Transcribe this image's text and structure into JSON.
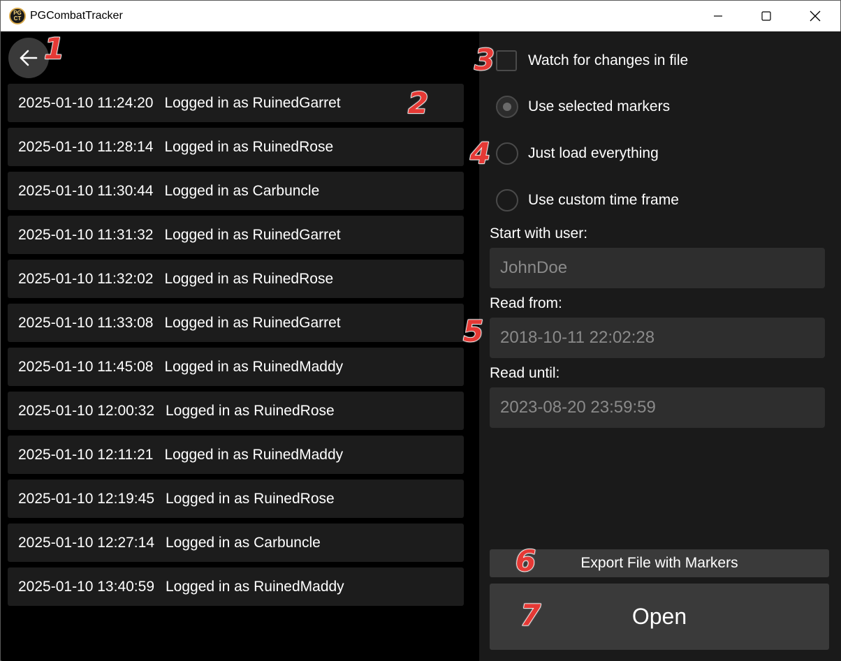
{
  "window": {
    "title": "PGCombatTracker",
    "icon_text": "PG\nCT"
  },
  "logins": [
    {
      "timestamp": "2025-01-10 11:24:20",
      "text": "Logged in as RuinedGarret"
    },
    {
      "timestamp": "2025-01-10 11:28:14",
      "text": "Logged in as RuinedRose"
    },
    {
      "timestamp": "2025-01-10 11:30:44",
      "text": "Logged in as Carbuncle"
    },
    {
      "timestamp": "2025-01-10 11:31:32",
      "text": "Logged in as RuinedGarret"
    },
    {
      "timestamp": "2025-01-10 11:32:02",
      "text": "Logged in as RuinedRose"
    },
    {
      "timestamp": "2025-01-10 11:33:08",
      "text": "Logged in as RuinedGarret"
    },
    {
      "timestamp": "2025-01-10 11:45:08",
      "text": "Logged in as RuinedMaddy"
    },
    {
      "timestamp": "2025-01-10 12:00:32",
      "text": "Logged in as RuinedRose"
    },
    {
      "timestamp": "2025-01-10 12:11:21",
      "text": "Logged in as RuinedMaddy"
    },
    {
      "timestamp": "2025-01-10 12:19:45",
      "text": "Logged in as RuinedRose"
    },
    {
      "timestamp": "2025-01-10 12:27:14",
      "text": "Logged in as Carbuncle"
    },
    {
      "timestamp": "2025-01-10 13:40:59",
      "text": "Logged in as RuinedMaddy"
    }
  ],
  "options": {
    "watch_label": "Watch for changes in file",
    "watch_checked": false,
    "radio_selected_markers": "Use selected markers",
    "radio_load_everything": "Just load everything",
    "radio_custom_time": "Use custom time frame",
    "selected": "selected_markers"
  },
  "fields": {
    "start_user_label": "Start with user:",
    "start_user_placeholder": "JohnDoe",
    "read_from_label": "Read from:",
    "read_from_placeholder": "2018-10-11 22:02:28",
    "read_until_label": "Read until:",
    "read_until_placeholder": "2023-08-20 23:59:59"
  },
  "buttons": {
    "export_label": "Export File with Markers",
    "open_label": "Open"
  },
  "annotations": [
    "1",
    "2",
    "3",
    "4",
    "5",
    "6",
    "7"
  ],
  "colors": {
    "annotation": "#e53935",
    "left_bg": "#000000",
    "right_bg": "#1a1a1a",
    "row_bg": "#1c1c1c",
    "button_bg": "#3a3a3a"
  }
}
